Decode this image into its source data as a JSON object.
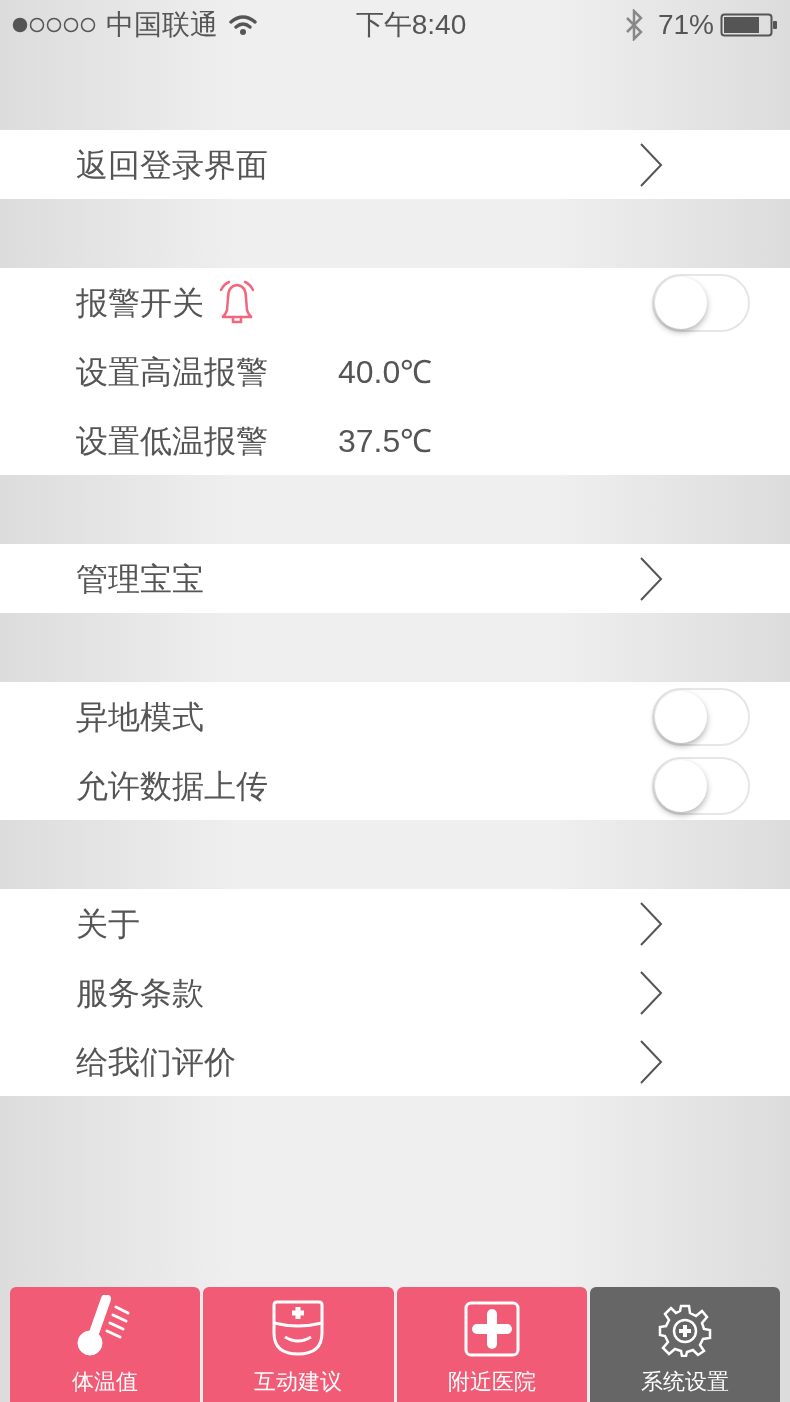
{
  "status_bar": {
    "carrier": "中国联通",
    "time": "下午8:40",
    "battery": "71%"
  },
  "sections": [
    {
      "rows": [
        {
          "kind": "link",
          "label": "返回登录界面"
        }
      ]
    },
    {
      "rows": [
        {
          "kind": "alarm-toggle",
          "label": "报警开关",
          "on": false
        },
        {
          "kind": "value",
          "label": "设置高温报警",
          "value": "40.0℃"
        },
        {
          "kind": "value",
          "label": "设置低温报警",
          "value": "37.5℃"
        }
      ]
    },
    {
      "rows": [
        {
          "kind": "link",
          "label": "管理宝宝"
        }
      ]
    },
    {
      "rows": [
        {
          "kind": "toggle",
          "label": "异地模式",
          "on": false
        },
        {
          "kind": "toggle",
          "label": "允许数据上传",
          "on": false
        }
      ]
    },
    {
      "rows": [
        {
          "kind": "link",
          "label": "关于"
        },
        {
          "kind": "link",
          "label": "服务条款"
        },
        {
          "kind": "link",
          "label": "给我们评价"
        }
      ]
    }
  ],
  "tabs": [
    {
      "label": "体温值",
      "selected": false
    },
    {
      "label": "互动建议",
      "selected": false
    },
    {
      "label": "附近医院",
      "selected": false
    },
    {
      "label": "系统设置",
      "selected": true
    }
  ]
}
